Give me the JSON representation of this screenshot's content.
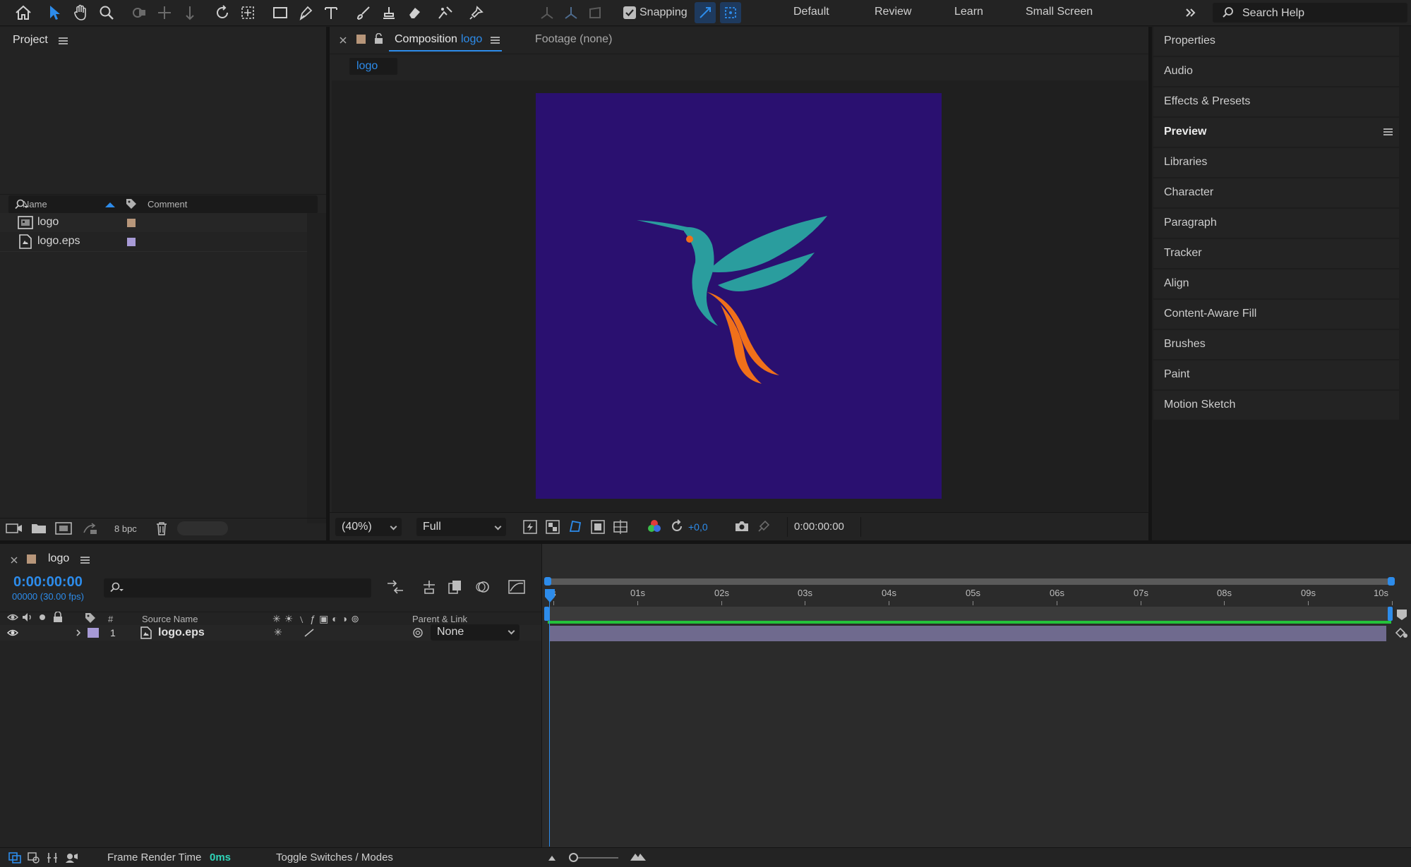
{
  "toolbar": {
    "snapping_label": "Snapping",
    "snapping_checked": true,
    "workspaces": [
      "Default",
      "Review",
      "Learn",
      "Small Screen"
    ],
    "search_placeholder": "Search Help"
  },
  "project": {
    "title": "Project",
    "columns": {
      "name": "Name",
      "comment": "Comment"
    },
    "items": [
      {
        "name": "logo",
        "type": "composition",
        "label_color": "#b7967a"
      },
      {
        "name": "logo.eps",
        "type": "footage",
        "label_color": "#a79ad6"
      }
    ],
    "bpc_label": "8 bpc"
  },
  "composition": {
    "tab_prefix": "Composition",
    "tab_name": "logo",
    "footage_tab": "Footage (none)",
    "breadcrumb": "logo",
    "canvas_color": "#2a1070",
    "zoom": "(40%)",
    "resolution": "Full",
    "exposure": "+0,0",
    "timecode": "0:00:00:00"
  },
  "right_panels": {
    "items": [
      "Properties",
      "Audio",
      "Effects & Presets",
      "Preview",
      "Libraries",
      "Character",
      "Paragraph",
      "Tracker",
      "Align",
      "Content-Aware Fill",
      "Brushes",
      "Paint",
      "Motion Sketch"
    ],
    "active": "Preview"
  },
  "timeline": {
    "tab_name": "logo",
    "current_time": "0:00:00:00",
    "frame_info": "00000 (30.00 fps)",
    "columns": {
      "num": "#",
      "source": "Source Name",
      "parent": "Parent & Link"
    },
    "layers": [
      {
        "num": "1",
        "name": "logo.eps",
        "parent": "None",
        "label_color": "#a79ad6"
      }
    ],
    "ruler": [
      "0s",
      "01s",
      "02s",
      "03s",
      "04s",
      "05s",
      "06s",
      "07s",
      "08s",
      "09s",
      "10s"
    ]
  },
  "status": {
    "render_label": "Frame Render Time",
    "render_value": "0ms",
    "toggle_label": "Toggle Switches / Modes"
  },
  "colors": {
    "accent_blue": "#2d8ceb",
    "bird_teal": "#2a9d9e",
    "bird_orange": "#f0701a",
    "layer_bar": "#6f6a8e",
    "work_area_green": "#24c23a"
  }
}
